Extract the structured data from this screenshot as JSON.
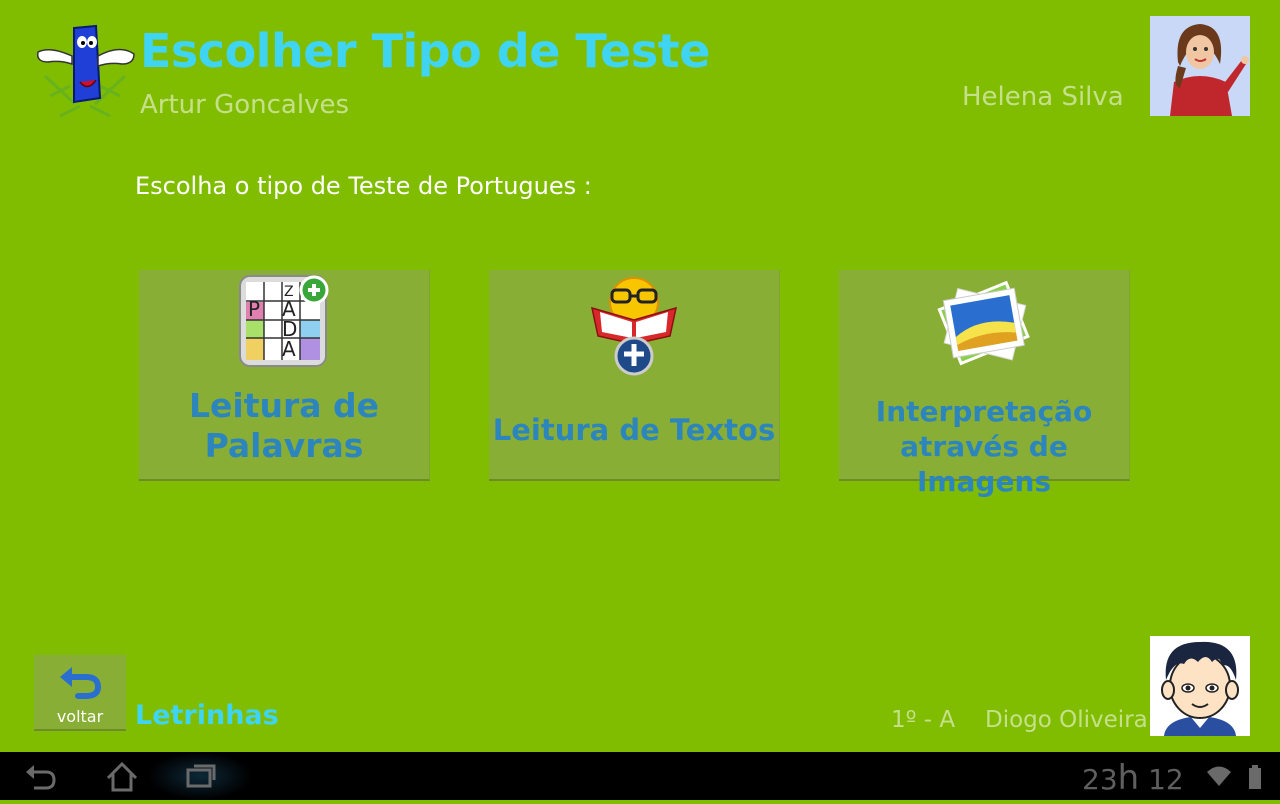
{
  "header": {
    "title": "Escolher Tipo de Teste",
    "subtitle": "Artur Goncalves",
    "teacher_name": "Helena Silva"
  },
  "main": {
    "prompt": "Escolha o tipo de Teste de Portugues :",
    "cards": [
      {
        "line1": "Leitura de",
        "line2": "Palavras",
        "icon": "word-puzzle-icon"
      },
      {
        "line1": "Leitura de Textos",
        "icon": "reading-smiley-icon"
      },
      {
        "line1": "Interpretação",
        "line2": "através de Imagens",
        "icon": "photos-icon"
      }
    ],
    "puzzle_letters": [
      "P",
      "A",
      "D",
      "A",
      "Z"
    ]
  },
  "footer": {
    "back_label": "voltar",
    "app_name": "Letrinhas",
    "class_label": "1º - A",
    "student_name": "Diogo Oliveira"
  },
  "system_bar": {
    "clock_hours": "23",
    "clock_h": "h",
    "clock_minutes": "12"
  },
  "colors": {
    "background": "#80bd00",
    "card": "#88ae35",
    "title": "#3fd4f2",
    "card_text": "#2c86bd"
  }
}
